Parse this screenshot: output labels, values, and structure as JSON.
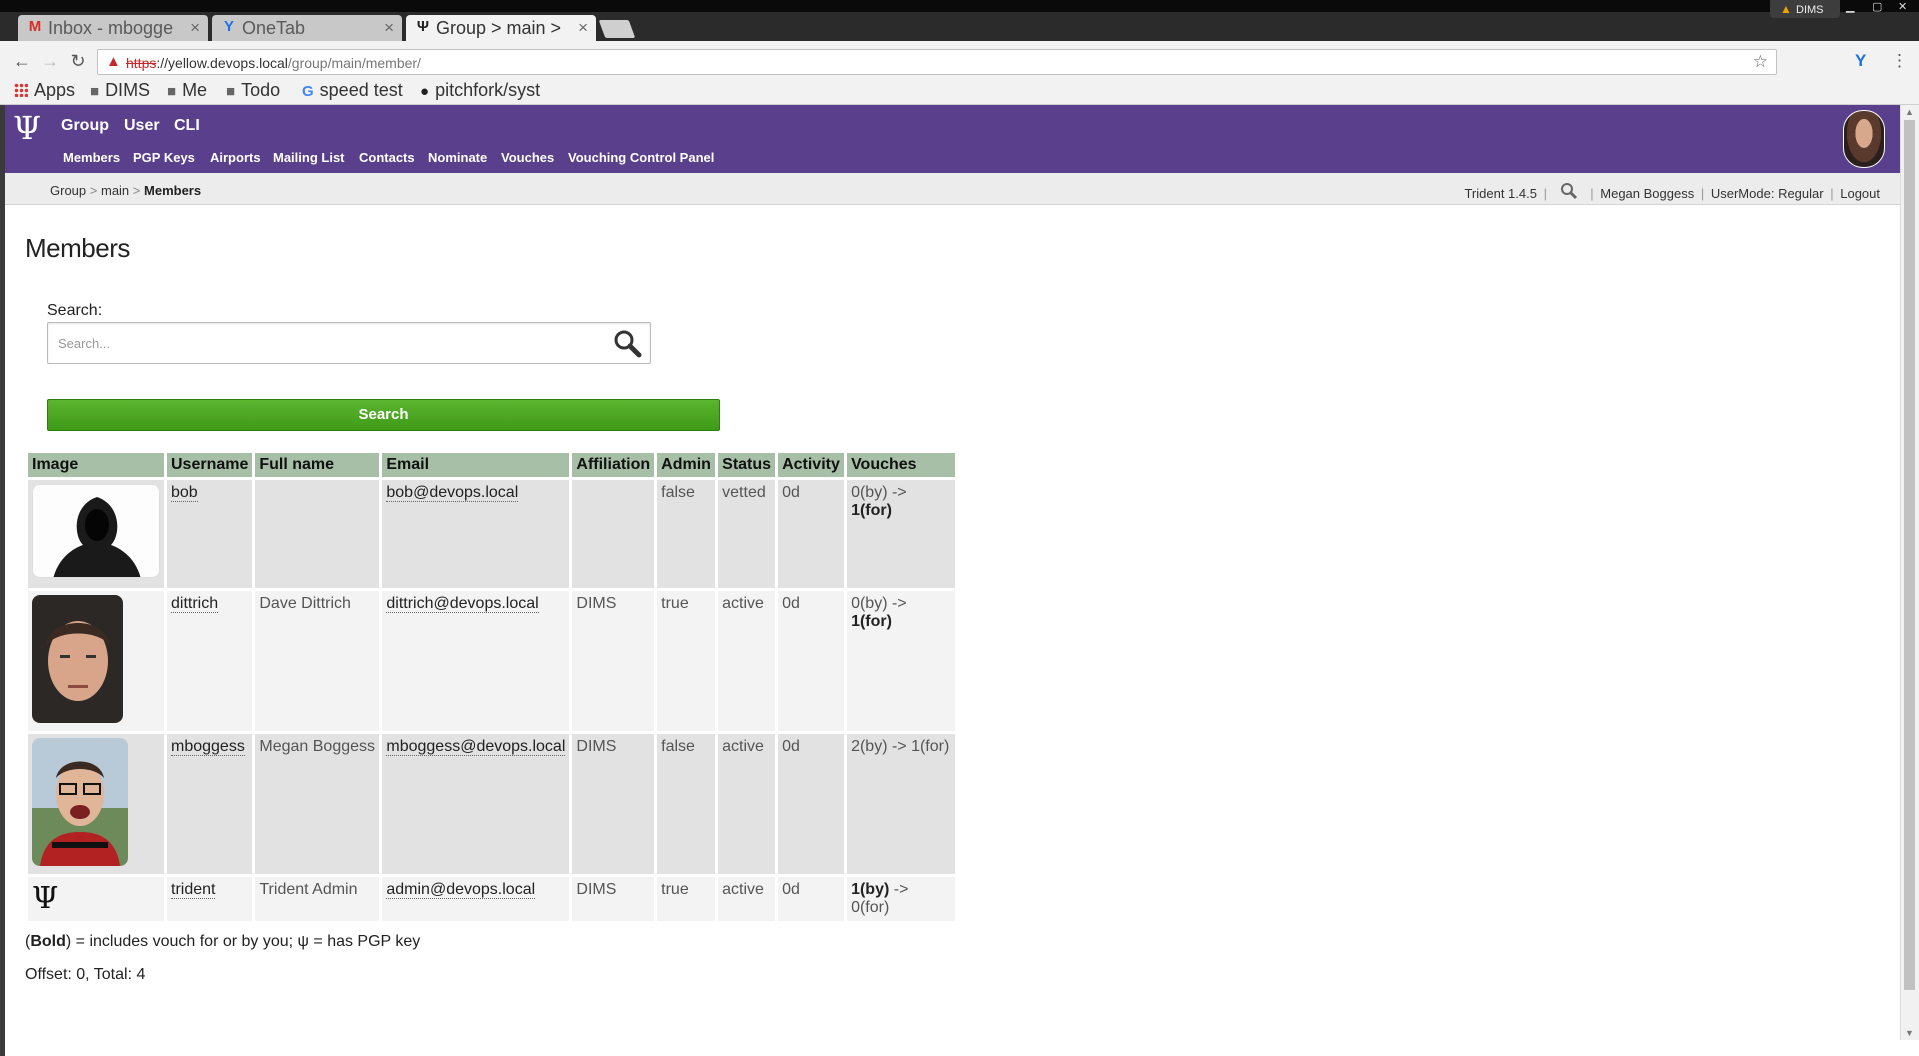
{
  "browser": {
    "tabs": [
      {
        "title": "Inbox - mbogge",
        "favicon": "gmail-icon"
      },
      {
        "title": "OneTab",
        "favicon": "onetab-icon"
      },
      {
        "title": "Group > main > ",
        "favicon": "trident-icon",
        "active": true
      }
    ],
    "window_user": "DIMS",
    "url": {
      "scheme": "https",
      "host": "://yellow.devops.local",
      "path": "/group/main/member/"
    },
    "bookmarks": [
      {
        "label": "Apps",
        "icon": "apps-grid-icon"
      },
      {
        "label": "DIMS",
        "icon": "folder-icon"
      },
      {
        "label": "Me",
        "icon": "folder-icon"
      },
      {
        "label": "Todo",
        "icon": "folder-icon"
      },
      {
        "label": "speed test",
        "icon": "google-icon"
      },
      {
        "label": "pitchfork/syst",
        "icon": "github-icon"
      }
    ]
  },
  "header": {
    "top_nav": [
      "Group",
      "User",
      "CLI"
    ],
    "sub_nav": [
      "Members",
      "PGP Keys",
      "Airports",
      "Mailing List",
      "Contacts",
      "Nominate",
      "Vouches",
      "Vouching Control Panel"
    ],
    "brand_color": "#5a3f8c"
  },
  "breadcrumb": {
    "items": [
      "Group",
      "main"
    ],
    "current": "Members",
    "separator": ">"
  },
  "userinfo": {
    "version": "Trident 1.4.5",
    "username": "Megan Boggess",
    "usermode_label": "UserMode:",
    "usermode": "Regular",
    "logout": "Logout"
  },
  "page": {
    "title": "Members",
    "search_label": "Search:",
    "search_placeholder": "Search...",
    "search_button": "Search"
  },
  "table": {
    "headers": [
      "Image",
      "Username",
      "Full name",
      "Email",
      "Affiliation",
      "Admin",
      "Status",
      "Activity",
      "Vouches"
    ],
    "rows": [
      {
        "username": "bob",
        "fullname": "",
        "email": "bob@devops.local",
        "affiliation": "",
        "admin": "false",
        "status": "vetted",
        "activity": "0d",
        "vouch_by": "0(by)",
        "vouch_arrow": " -> ",
        "vouch_for": "1(for)",
        "bold": "for",
        "image": "hooded-figure-photo"
      },
      {
        "username": "dittrich",
        "fullname": "Dave Dittrich",
        "email": "dittrich@devops.local",
        "affiliation": "DIMS",
        "admin": "true",
        "status": "active",
        "activity": "0d",
        "vouch_by": "0(by)",
        "vouch_arrow": " -> ",
        "vouch_for": "1(for)",
        "bold": "for",
        "image": "man-portrait-photo"
      },
      {
        "username": "mboggess",
        "fullname": "Megan Boggess",
        "email": "mboggess@devops.local",
        "affiliation": "DIMS",
        "admin": "false",
        "status": "active",
        "activity": "0d",
        "vouch_by": "2(by)",
        "vouch_arrow": " -> ",
        "vouch_for": "1(for)",
        "bold": "none",
        "image": "person-glasses-photo"
      },
      {
        "username": "trident",
        "fullname": "Trident Admin",
        "email": "admin@devops.local",
        "affiliation": "DIMS",
        "admin": "true",
        "status": "active",
        "activity": "0d",
        "vouch_by": "1(by)",
        "vouch_arrow": " -> ",
        "vouch_for": "0(for)",
        "bold": "by",
        "image": "trident-icon"
      }
    ]
  },
  "legend": {
    "bold_word": "Bold",
    "text": ") = includes vouch for or by you; ψ = has PGP key",
    "open": "("
  },
  "offset_text": "Offset: 0, Total: 4"
}
